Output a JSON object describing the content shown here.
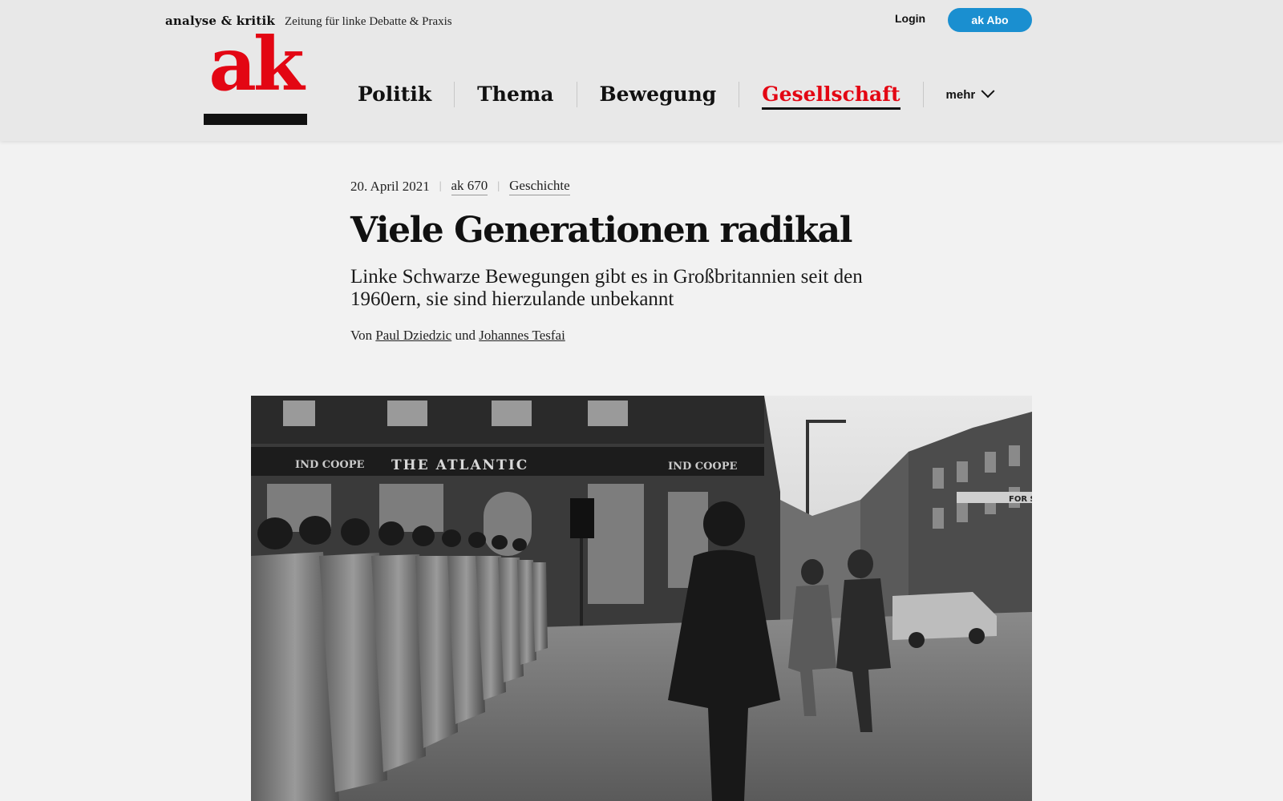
{
  "header": {
    "brand_name": "analyse & kritik",
    "tagline": "Zeitung für linke Debatte & Praxis",
    "login_label": "Login",
    "subscribe_label": "ak Abo",
    "logo_text": "ak",
    "accent_color": "#e30613",
    "button_color": "#1a8fd0"
  },
  "nav": {
    "items": [
      {
        "label": "Politik"
      },
      {
        "label": "Thema"
      },
      {
        "label": "Bewegung"
      },
      {
        "label": "Gesellschaft",
        "active": true
      }
    ],
    "more_label": "mehr",
    "more_icon": "chevron-down-icon"
  },
  "article": {
    "date": "20. April 2021",
    "issue": "ak 670",
    "category": "Geschichte",
    "title": "Viele Generationen radikal",
    "subtitle": "Linke Schwarze Bewegungen gibt es in Großbritannien seit den 1960ern, sie sind hierzulande unbekannt",
    "byline_prefix": "Von",
    "authors": [
      "Paul Dziedzic",
      "Johannes Tesfai"
    ],
    "byline_joiner": "und"
  },
  "hero_image": {
    "sign_main": "THE ATLANTIC",
    "sign_left": "IND COOPE",
    "sign_right": "IND COOPE",
    "shop_sign": "FOR SA"
  }
}
